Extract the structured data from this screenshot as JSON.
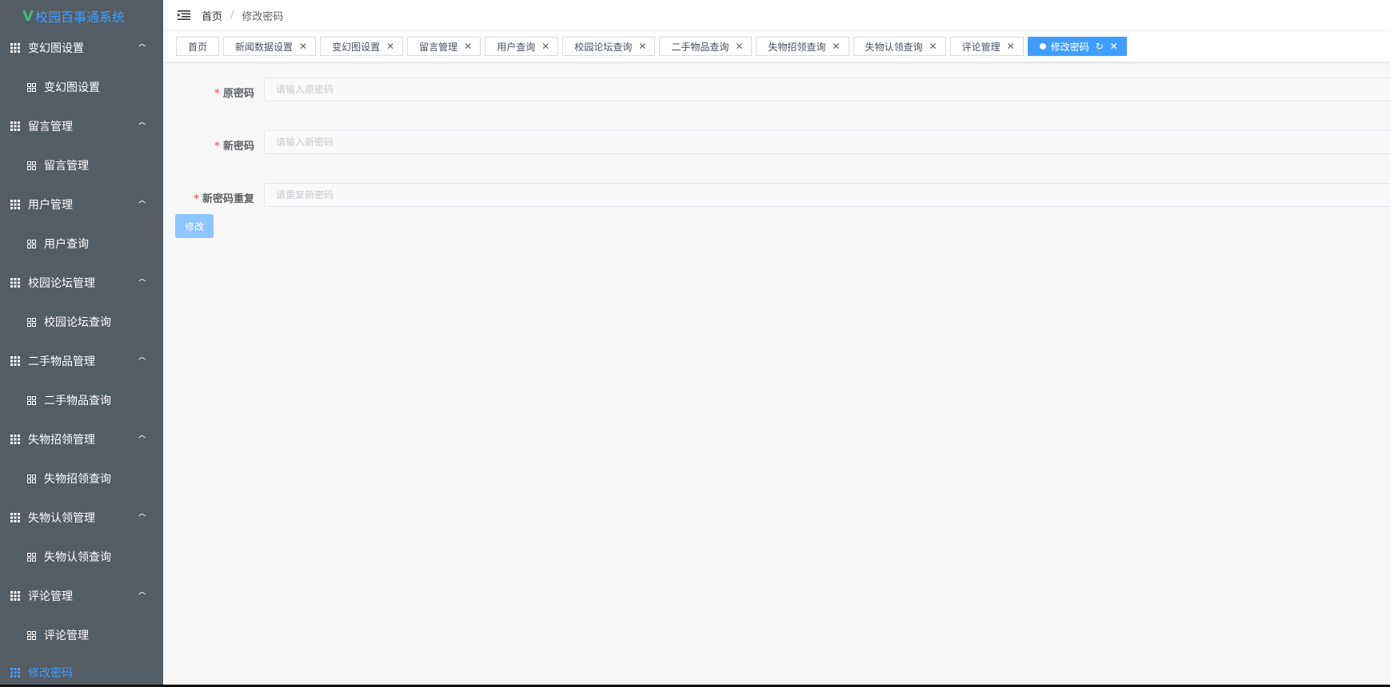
{
  "app": {
    "title_mark": "V",
    "title": "校园百事通系统"
  },
  "sidebar": {
    "groups": [
      {
        "title": "变幻图设置",
        "item": "变幻图设置"
      },
      {
        "title": "留言管理",
        "item": "留言管理"
      },
      {
        "title": "用户管理",
        "item": "用户查询"
      },
      {
        "title": "校园论坛管理",
        "item": "校园论坛查询"
      },
      {
        "title": "二手物品管理",
        "item": "二手物品查询"
      },
      {
        "title": "失物招领管理",
        "item": "失物招领查询"
      },
      {
        "title": "失物认领管理",
        "item": "失物认领查询"
      },
      {
        "title": "评论管理",
        "item": "评论管理"
      }
    ],
    "active_item": "修改密码",
    "expand_arrow": "^"
  },
  "header": {
    "breadcrumb": {
      "home": "首页",
      "separator": "/",
      "current": "修改密码"
    }
  },
  "tabs": [
    {
      "label": "首页",
      "closable": false
    },
    {
      "label": "新闻数据设置",
      "closable": true
    },
    {
      "label": "变幻图设置",
      "closable": true
    },
    {
      "label": "留言管理",
      "closable": true
    },
    {
      "label": "用户查询",
      "closable": true
    },
    {
      "label": "校园论坛查询",
      "closable": true
    },
    {
      "label": "二手物品查询",
      "closable": true
    },
    {
      "label": "失物招领查询",
      "closable": true
    },
    {
      "label": "失物认领查询",
      "closable": true
    },
    {
      "label": "评论管理",
      "closable": true
    },
    {
      "label": "修改密码",
      "closable": true,
      "active": true
    }
  ],
  "form": {
    "fields": [
      {
        "label": "原密码",
        "required_mark": "*",
        "placeholder": "请输入原密码",
        "value": ""
      },
      {
        "label": "新密码",
        "required_mark": "*",
        "placeholder": "请输入新密码",
        "value": ""
      },
      {
        "label": "新密码重复",
        "required_mark": "*",
        "placeholder": "请重复新密码",
        "value": ""
      }
    ],
    "submit_label": "修改"
  },
  "colors": {
    "sidebar_bg": "#545c64",
    "accent": "#409eff",
    "logo_mark": "#41b883",
    "required": "#f56c6c",
    "submit_bg": "#8cc5ff"
  },
  "icons": {
    "hamburger": "menu-fold-icon",
    "group": "grid-icon",
    "item": "apps-icon",
    "close": "close-icon",
    "refresh": "refresh-icon"
  }
}
